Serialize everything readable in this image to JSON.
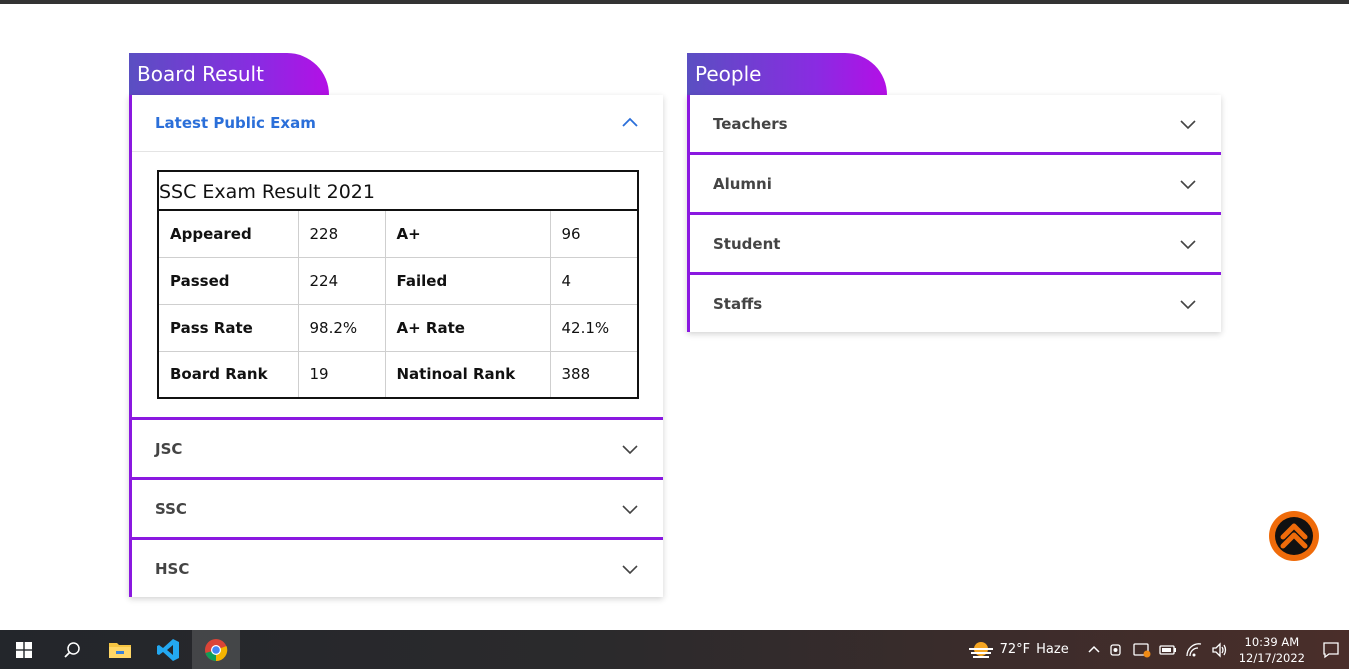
{
  "board_result": {
    "title": "Board Result",
    "latest": {
      "label": "Latest Public Exam",
      "table_title": "SSC Exam Result 2021",
      "rows": [
        {
          "l1": "Appeared",
          "v1": "228",
          "l2": "A+",
          "v2": "96"
        },
        {
          "l1": "Passed",
          "v1": "224",
          "l2": "Failed",
          "v2": "4"
        },
        {
          "l1": "Pass Rate",
          "v1": "98.2%",
          "l2": "A+ Rate",
          "v2": "42.1%"
        },
        {
          "l1": "Board Rank",
          "v1": "19",
          "l2": "Natinoal Rank",
          "v2": "388"
        }
      ]
    },
    "items": [
      "JSC",
      "SSC",
      "HSC"
    ]
  },
  "people": {
    "title": "People",
    "items": [
      "Teachers",
      "Alumni",
      "Student",
      "Staffs"
    ]
  },
  "colors": {
    "accent": "#8a18e0",
    "link_blue": "#2b6fd9",
    "back_to_top": "#ef6b0a"
  },
  "taskbar": {
    "apps": [
      "windows-start",
      "search",
      "file-explorer",
      "vscode",
      "chrome"
    ],
    "weather_temp": "72°F",
    "weather_text": "Haze",
    "time": "10:39 AM",
    "date": "12/17/2022"
  }
}
